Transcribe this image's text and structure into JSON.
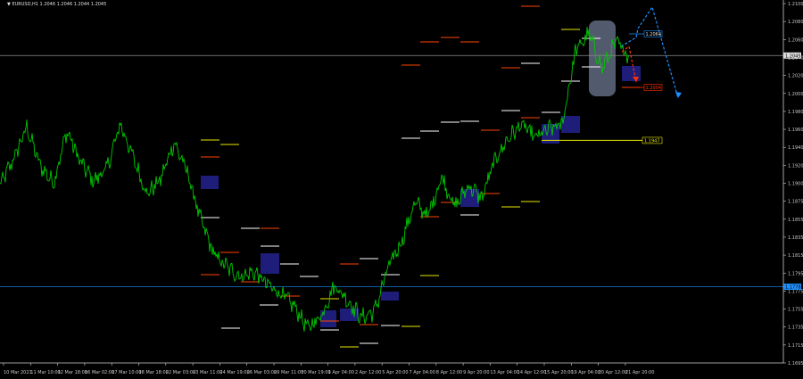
{
  "chart_title": "EURUSD,H1  1.2046 1.2046 1.2044 1.2045",
  "chart_data": {
    "type": "line",
    "series": [
      {
        "values_index": [
          0,
          15,
          30,
          45,
          60,
          75,
          90,
          105,
          120,
          135,
          150,
          165,
          180,
          195,
          210,
          225,
          240,
          255,
          270,
          285,
          300,
          315,
          330,
          345,
          360,
          375,
          390,
          405,
          420,
          435,
          450,
          465,
          480,
          495,
          510,
          525,
          540,
          555,
          570,
          585,
          600,
          615,
          630,
          645,
          660,
          675,
          690,
          705
        ],
        "values": [
          1.1895,
          1.1925,
          1.1962,
          1.1918,
          1.1898,
          1.1958,
          1.1922,
          1.19,
          1.1915,
          1.1966,
          1.1925,
          1.1885,
          1.1902,
          1.1945,
          1.191,
          1.1855,
          1.1815,
          1.18,
          1.179,
          1.1795,
          1.178,
          1.177,
          1.1755,
          1.173,
          1.1745,
          1.178,
          1.1762,
          1.1742,
          1.175,
          1.18,
          1.183,
          1.1875,
          1.186,
          1.1905,
          1.187,
          1.1895,
          1.188,
          1.1925,
          1.195,
          1.1965,
          1.195,
          1.196,
          1.1965,
          1.205,
          1.207,
          1.203,
          1.206,
          1.2045
        ]
      }
    ],
    "y_ticks": [
      "1.2100",
      "1.2080",
      "1.2060",
      "1.2040",
      "1.2020",
      "1.2000",
      "1.1980",
      "1.1960",
      "1.1940",
      "1.1920",
      "1.1900",
      "1.1875",
      "1.1855",
      "1.1835",
      "1.1815",
      "1.1795",
      "1.1775",
      "1.1755",
      "1.1735",
      "1.1715",
      "1.1695"
    ],
    "x_ticks": [
      "10 Mar 2021",
      "11 Mar 10:00",
      "12 Mar 18:00",
      "16 Mar 02:00",
      "17 Mar 10:00",
      "18 Mar 18:00",
      "22 Mar 03:00",
      "23 Mar 11:00",
      "24 Mar 19:00",
      "26 Mar 03:00",
      "29 Mar 11:00",
      "30 Mar 19:00",
      "1 Apr 04:00",
      "2 Apr 12:00",
      "5 Apr 20:00",
      "7 Apr 04:00",
      "8 Apr 12:00",
      "9 Apr 20:00",
      "13 Apr 04:00",
      "14 Apr 12:00",
      "15 Apr 20:00",
      "19 Apr 04:00",
      "20 Apr 12:00",
      "21 Apr 20:00"
    ],
    "ylim": [
      1.169,
      1.2105
    ],
    "grid": false,
    "horizontal_lines": [
      {
        "price": 1.2045,
        "label": "1.2045"
      },
      {
        "price": 1.1778,
        "label": "1.1778"
      }
    ],
    "annotation_tags": [
      {
        "label": "1.2064",
        "price": 1.2064,
        "color": "#1e90ff"
      },
      {
        "label": "1.2004",
        "price": 1.2004,
        "color": "#ff4000"
      },
      {
        "label": "1.1947",
        "price": 1.1947,
        "color": "#e8e800"
      }
    ],
    "colors": {
      "candle_line": "#00c800",
      "background": "#000000",
      "grid_text": "#c8c8c8",
      "hline_grey": "#8c8c8c",
      "hline_blue": "#1e90ff",
      "box_navy": "#1e1e7a",
      "pill": "#6e7891",
      "projection_blue": "#1e90ff",
      "projection_red": "#ff3000",
      "level_orange": "#ff4500",
      "level_white": "#ffffff",
      "level_yellow": "#e8e800"
    }
  }
}
